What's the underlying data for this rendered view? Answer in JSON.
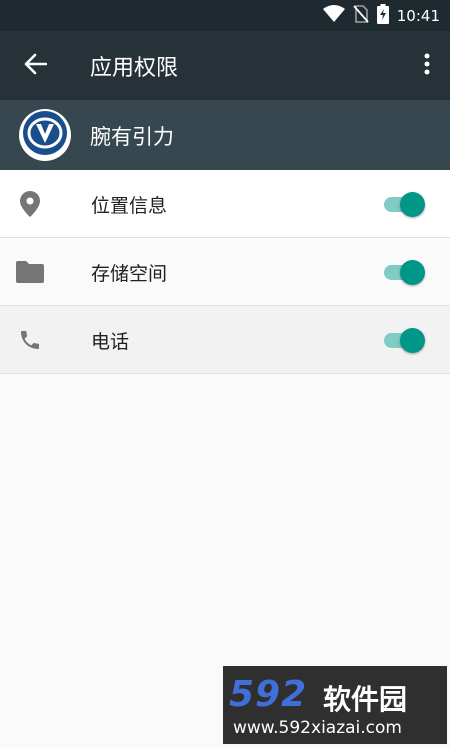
{
  "status_bar": {
    "time": "10:41",
    "icons": [
      "wifi-icon",
      "no-sim-icon",
      "battery-charging-icon"
    ]
  },
  "app_bar": {
    "title": "应用权限",
    "back_icon": "arrow-back-icon",
    "more_icon": "more-vert-icon"
  },
  "app_header": {
    "name": "腕有引力",
    "logo_icon": "changan-v-logo"
  },
  "permissions": [
    {
      "label": "位置信息",
      "icon": "location-pin-icon",
      "enabled": true
    },
    {
      "label": "存储空间",
      "icon": "folder-icon",
      "enabled": true
    },
    {
      "label": "电话",
      "icon": "phone-icon",
      "enabled": true
    }
  ],
  "watermark": {
    "brand_number": "592",
    "brand_text": "软件园",
    "url": "www.592xiazai.com"
  },
  "colors": {
    "status_bar": "#1f2a30",
    "app_bar": "#263238",
    "app_header": "#37474f",
    "toggle_thumb": "#009688",
    "toggle_track": "#80cbc4",
    "background": "#fafafa"
  }
}
